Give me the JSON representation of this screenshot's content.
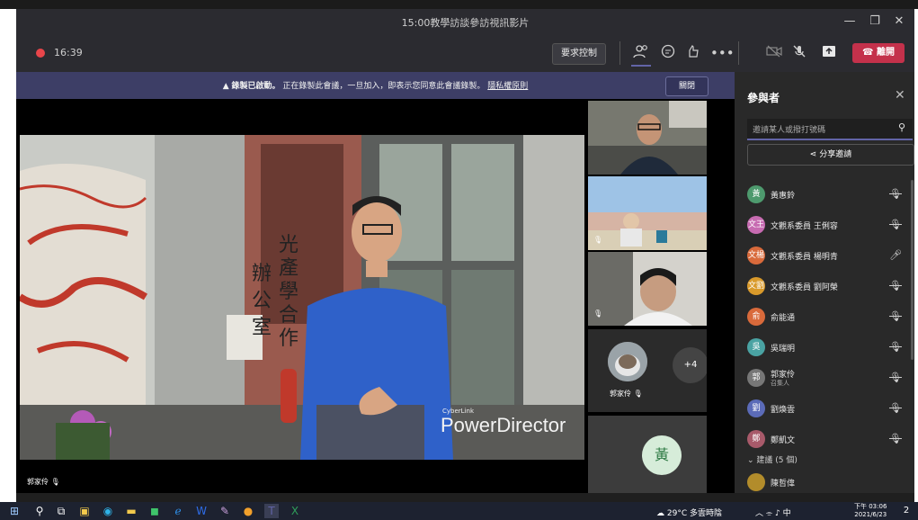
{
  "window": {
    "title": "15:00教學訪談參訪視訊影片"
  },
  "toolbar": {
    "timer": "16:39",
    "request_control_label": "要求控制",
    "leave_label": "離開"
  },
  "banner": {
    "text_bold": "錄製已啟動。",
    "text": "正在錄製此會議，一旦加入，即表示您同意此會議錄製。",
    "link": "隱私權原則",
    "close_label": "關閉"
  },
  "main_video": {
    "speaker_label": "郭家伶",
    "watermark_small": "CyberLink",
    "watermark": "PowerDirector",
    "sign_chars": [
      "光",
      "產",
      "學",
      "合",
      "作",
      "辦",
      "公",
      "室"
    ]
  },
  "tiles": {
    "avatar_name": "郭家伶",
    "overflow_count": "+4",
    "huang_initial": "黃"
  },
  "panel": {
    "title": "參與者",
    "invite_placeholder": "邀請某人或撥打號碼",
    "share_label": "分享邀請",
    "participants": [
      {
        "initial": "黃",
        "name": "黃惠鈴",
        "color": "#4e9a6e",
        "mic": "muted"
      },
      {
        "initial": "文王",
        "name": "文觀系委員 王俐容",
        "color": "#c76bb1",
        "mic": "muted"
      },
      {
        "initial": "文楊",
        "name": "文觀系委員 楊明青",
        "color": "#d96a3b",
        "mic": "on"
      },
      {
        "initial": "文劉",
        "name": "文觀系委員 劉阿榮",
        "color": "#d99a2b",
        "mic": "muted"
      },
      {
        "initial": "俞",
        "name": "俞能通",
        "color": "#d96a3b",
        "mic": "muted"
      },
      {
        "initial": "吳",
        "name": "吳瑞明",
        "color": "#4aa3a3",
        "mic": "muted"
      },
      {
        "initial": "郭",
        "name": "郭家伶",
        "sub": "召集人",
        "color": "#777777",
        "mic": "muted"
      },
      {
        "initial": "劉",
        "name": "劉煥雲",
        "color": "#5b6bb8",
        "mic": "muted"
      },
      {
        "initial": "鄭",
        "name": "鄭凱文",
        "color": "#a85a6a",
        "mic": "muted"
      }
    ],
    "suggested_header": "建議 (5 個)",
    "suggested": [
      {
        "name": "陳哲偉"
      }
    ]
  },
  "taskbar": {
    "weather": "29°C 多雲時陰",
    "ime": "中",
    "time": "下午 03:06",
    "date": "2021/6/23",
    "notif_count": "2"
  },
  "colors": {
    "accent": "#6264a7",
    "leave": "#c4314b",
    "record": "#e8454a"
  }
}
